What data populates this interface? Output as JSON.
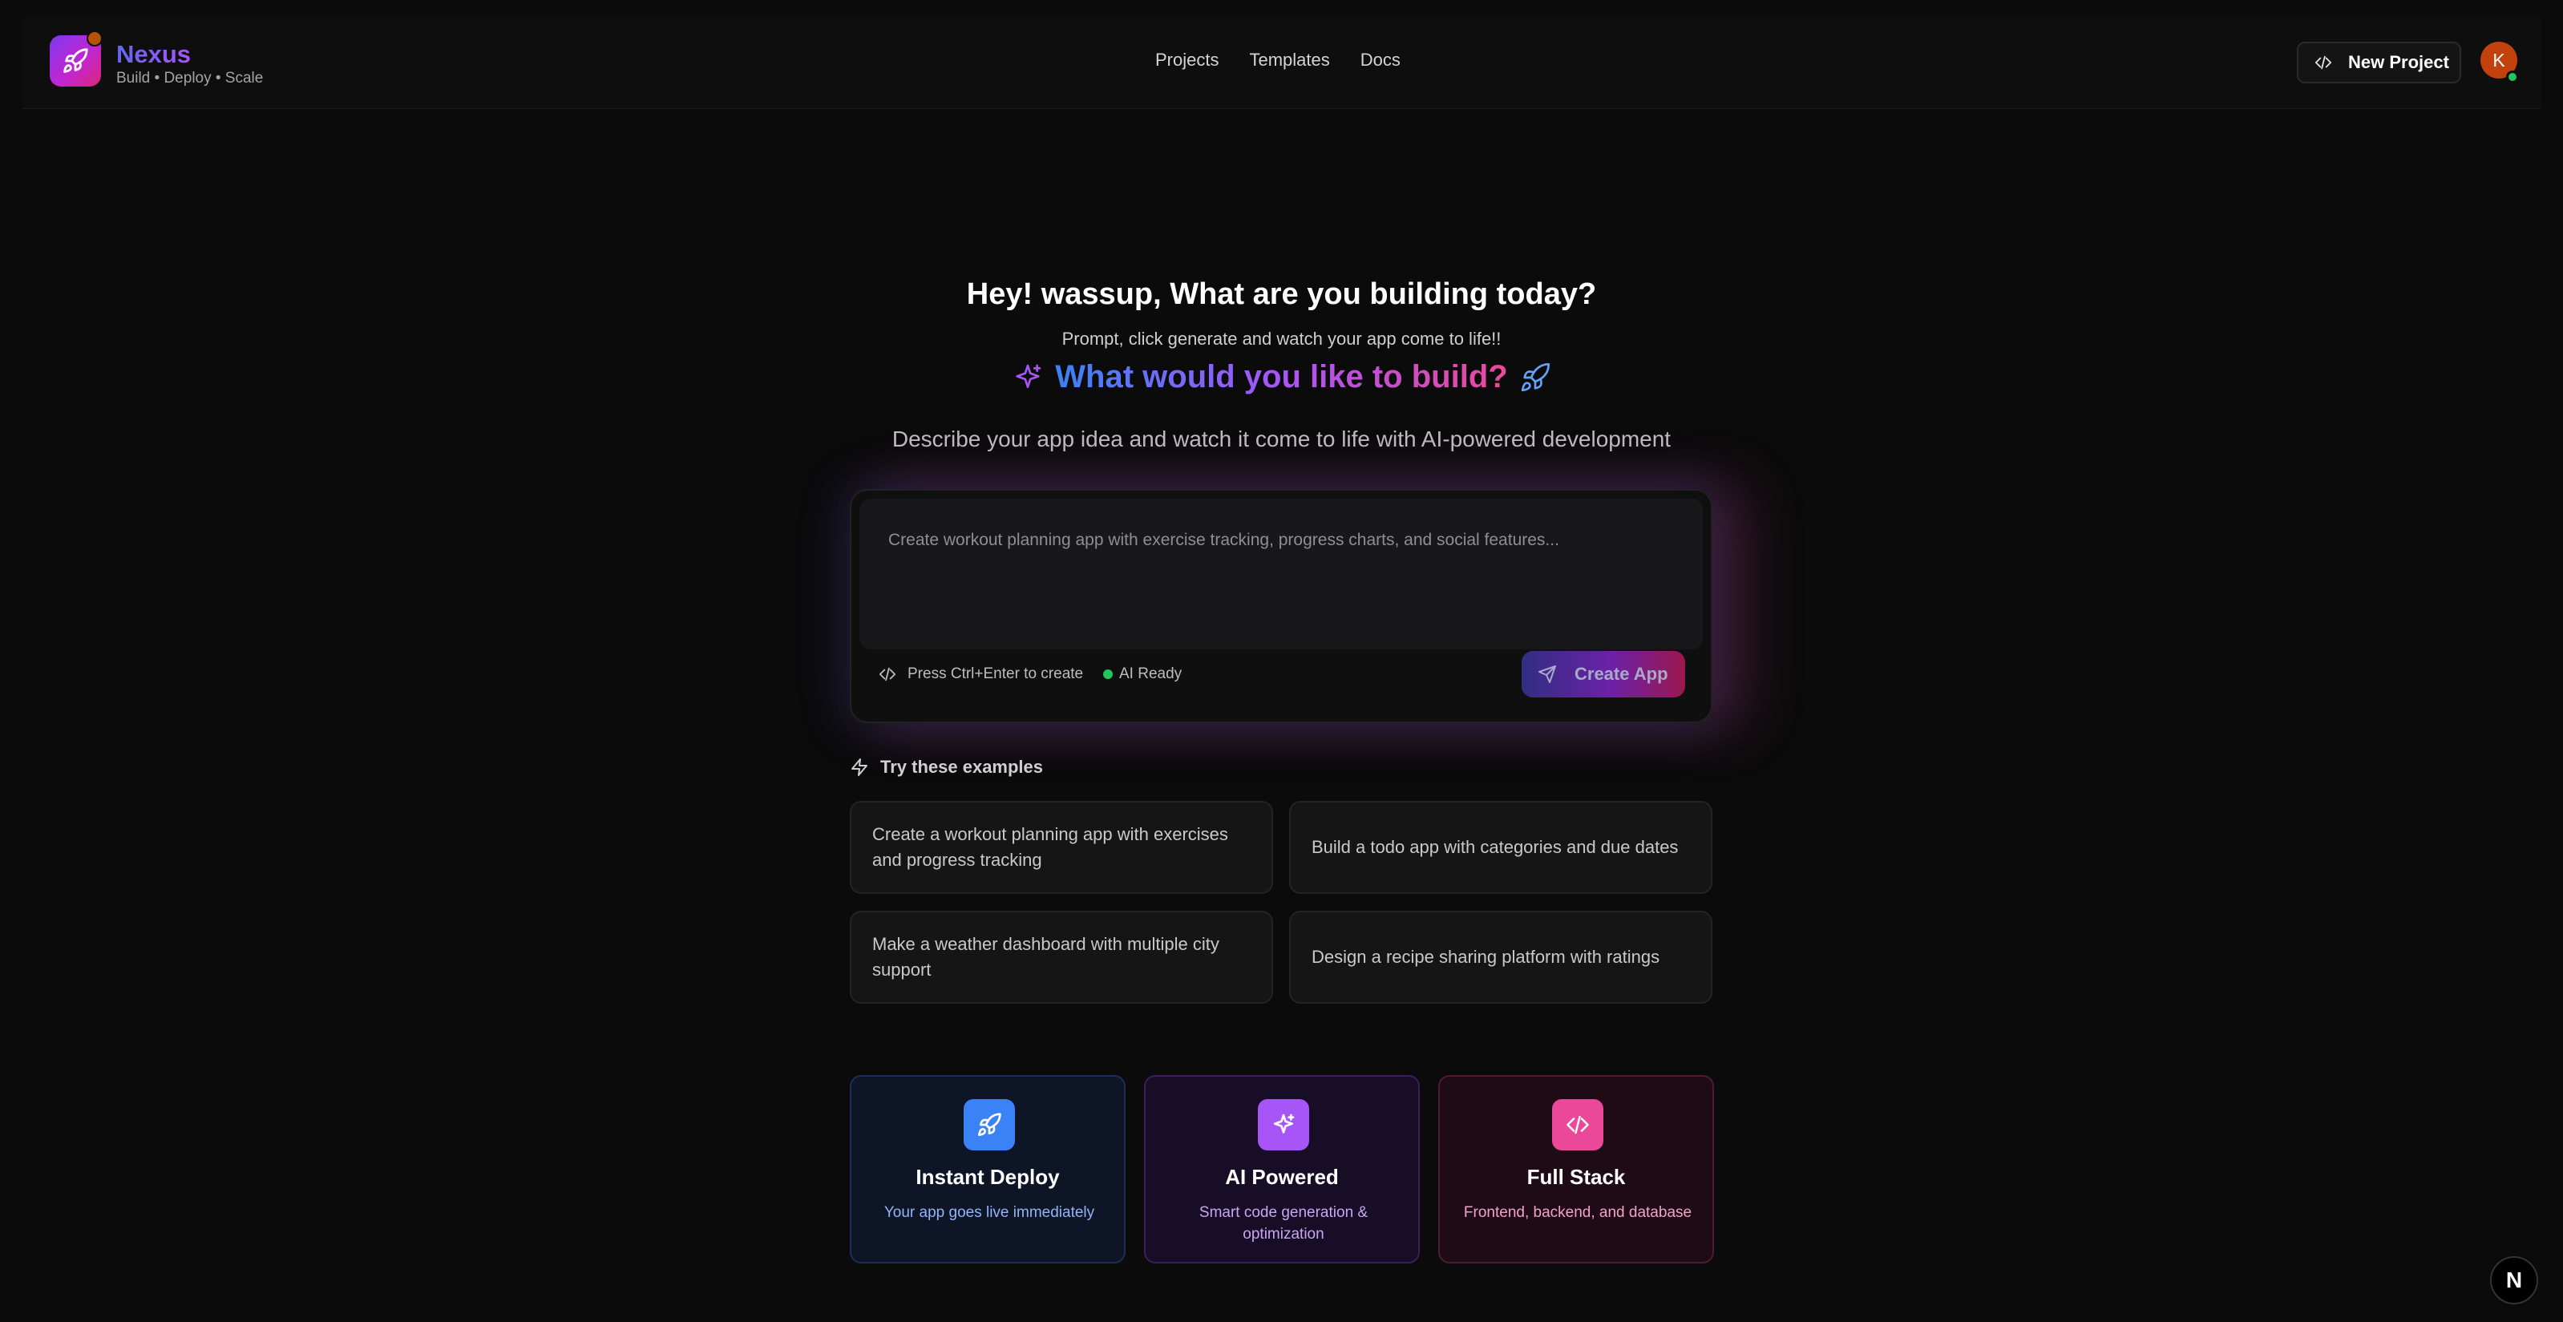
{
  "brand": {
    "name": "Nexus",
    "tagline": "Build • Deploy • Scale",
    "logo_icon": "rocket-icon"
  },
  "nav": {
    "items": [
      "Projects",
      "Templates",
      "Docs"
    ]
  },
  "header": {
    "new_project_label": "New Project",
    "avatar_initial": "K"
  },
  "hero": {
    "title": "Hey! wassup, What are you building today?",
    "subtitle": "Prompt, click generate and watch your app come to life!!",
    "question": "What would you like to build?",
    "description": "Describe your app idea and watch it come to life with AI-powered development"
  },
  "prompt": {
    "placeholder": "Create workout planning app with exercise tracking, progress charts, and social features...",
    "hint": "Press Ctrl+Enter to create",
    "status": "AI Ready",
    "create_label": "Create App"
  },
  "examples": {
    "heading": "Try these examples",
    "items": [
      "Create a workout planning app with exercises and progress tracking",
      "Build a todo app with categories and due dates",
      "Make a weather dashboard with multiple city support",
      "Design a recipe sharing platform with ratings"
    ]
  },
  "features": [
    {
      "title": "Instant Deploy",
      "description": "Your app goes live immediately",
      "icon": "rocket-icon",
      "accent": "#3b82f6"
    },
    {
      "title": "AI Powered",
      "description": "Smart code generation & optimization",
      "icon": "sparkles-icon",
      "accent": "#a855f7"
    },
    {
      "title": "Full Stack",
      "description": "Frontend, backend, and database",
      "icon": "code-icon",
      "accent": "#ec4899"
    }
  ],
  "corner_badge": "N",
  "colors": {
    "background": "#0b0b0b",
    "blue": "#3b82f6",
    "purple": "#a855f7",
    "pink": "#ec4899",
    "ready": "#22c55e"
  }
}
